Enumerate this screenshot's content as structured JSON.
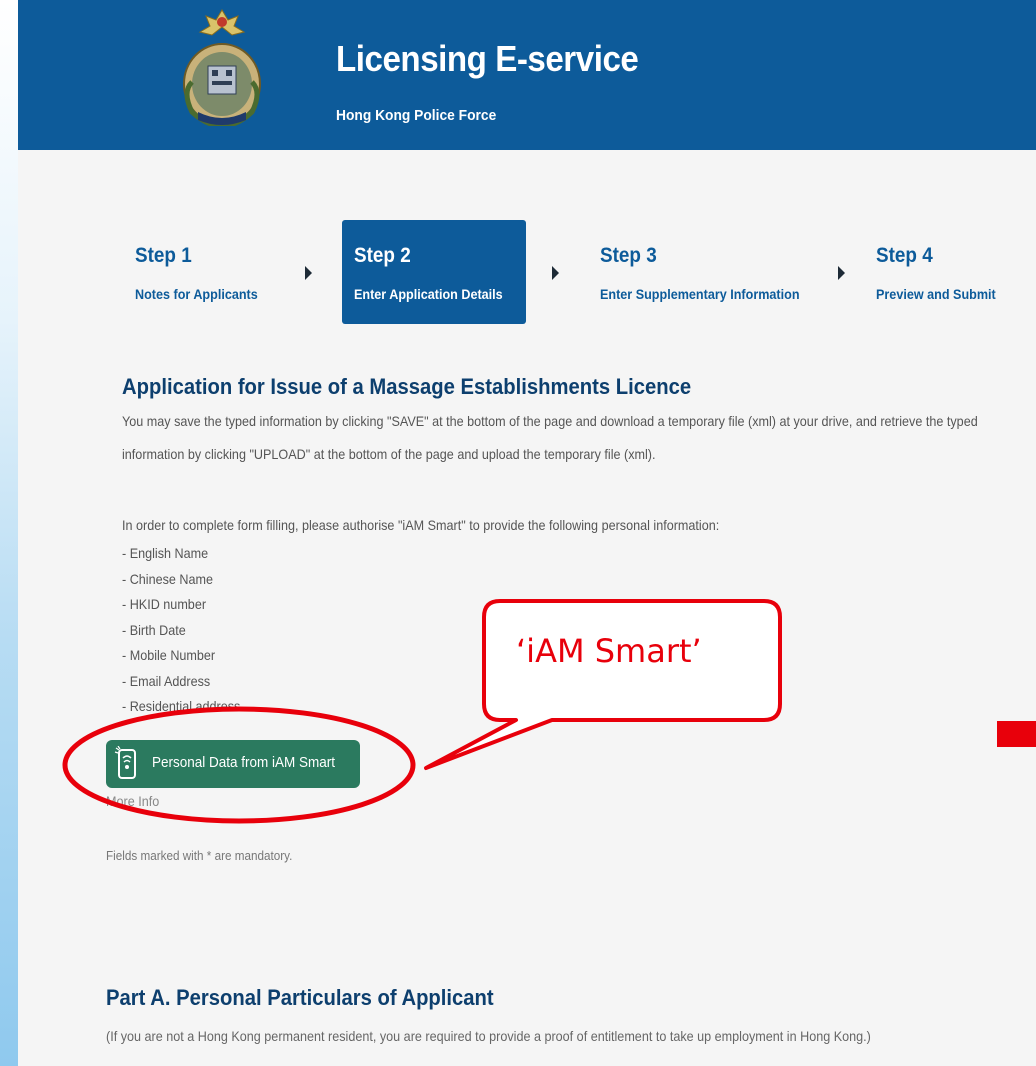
{
  "header": {
    "title": "Licensing E-service",
    "subtitle": "Hong Kong Police Force",
    "colors": {
      "bar": "#0d5b9a",
      "text": "#ffffff"
    }
  },
  "stepper": {
    "steps": [
      {
        "number": "Step 1",
        "label": "Notes for Applicants",
        "active": false
      },
      {
        "number": "Step 2",
        "label": "Enter Application Details",
        "active": true
      },
      {
        "number": "Step 3",
        "label": "Enter Supplementary Information",
        "active": false
      },
      {
        "number": "Step 4",
        "label": "Preview and Submit",
        "active": false
      }
    ]
  },
  "form": {
    "title": "Application for Issue of a Massage Establishments Licence",
    "intro_line1": "You may save the typed information by clicking \"SAVE\" at the bottom of the page and download a temporary file (xml) at your drive, and retrieve the typed",
    "intro_line2": "information by clicking \"UPLOAD\" at the bottom of the page and upload the temporary file (xml).",
    "authorise_text": "In order to complete form filling, please authorise \"iAM Smart\" to provide the following personal information:",
    "personal_info_items": [
      "- English Name",
      "- Chinese Name",
      "- HKID number",
      "- Birth Date",
      "- Mobile Number",
      "- Email Address",
      "- Residential address"
    ],
    "iam_button_label": "Personal Data from iAM Smart",
    "more_info": "More Info",
    "mandatory_note": "Fields marked with * are mandatory."
  },
  "part_a": {
    "title": "Part A. Personal Particulars of Applicant",
    "note": "(If you are not a Hong Kong permanent resident, you are required to provide a proof of entitlement to take up employment in Hong Kong.)"
  },
  "annotation": {
    "callout_text": "‘iAM Smart’",
    "color": "#e8000b"
  },
  "icons": [
    "police-crest-icon",
    "step-arrow-icon",
    "iam-smart-phone-icon"
  ]
}
